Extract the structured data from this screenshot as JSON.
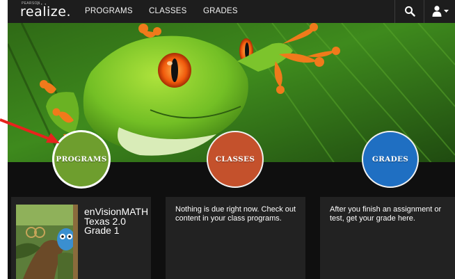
{
  "nav": {
    "brand_small": "PEARSON",
    "brand": "realize.",
    "items": [
      "PROGRAMS",
      "CLASSES",
      "GRADES"
    ],
    "icons": [
      "search-icon",
      "user-icon",
      "caret-down-icon"
    ]
  },
  "hero": {
    "circles": [
      {
        "label": "PROGRAMS",
        "color": "#6e9e2e"
      },
      {
        "label": "CLASSES",
        "color": "#c4512c"
      },
      {
        "label": "GRADES",
        "color": "#1f6fc2"
      }
    ]
  },
  "cards": {
    "program": {
      "title_lines": [
        "enVisionMATH",
        "Texas 2.0",
        "Grade 1"
      ]
    },
    "classes": {
      "text": "Nothing is due right now. Check out content in your class programs."
    },
    "grades": {
      "text": "After you finish an assignment or test, get your grade here."
    }
  },
  "annotation": {
    "arrow_color": "#e8231d"
  }
}
